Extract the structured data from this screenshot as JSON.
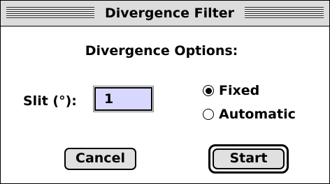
{
  "window": {
    "title": "Divergence Filter"
  },
  "dialog": {
    "heading": "Divergence Options:",
    "slit": {
      "label": "Slit (°):",
      "value": "1"
    },
    "mode_options": [
      {
        "label": "Fixed",
        "selected": true
      },
      {
        "label": "Automatic",
        "selected": false
      }
    ]
  },
  "buttons": {
    "cancel_label": "Cancel",
    "start_label": "Start"
  },
  "colors": {
    "titlebar": "#dcdcdc",
    "input_background": "#d8d8ff",
    "button_face": "#e0e0e0"
  }
}
